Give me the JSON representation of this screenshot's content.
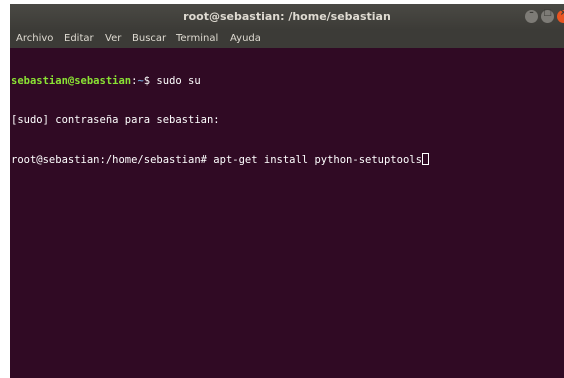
{
  "window": {
    "title": "root@sebastian: /home/sebastian"
  },
  "menu": {
    "items": [
      "Archivo",
      "Editar",
      "Ver",
      "Buscar",
      "Terminal",
      "Ayuda"
    ]
  },
  "terminal": {
    "line1": {
      "user_host": "sebastian@sebastian",
      "sep": ":",
      "path": "~",
      "prompt": "$ ",
      "command": "sudo su"
    },
    "line2": {
      "text": "[sudo] contraseña para sebastian:"
    },
    "line3": {
      "prompt": "root@sebastian:/home/sebastian# ",
      "command": "apt-get install python-setuptools"
    }
  },
  "colors": {
    "background": "#300a24",
    "prompt_user": "#8ae234",
    "prompt_path": "#729fcf",
    "titlebar": "#3c3b37",
    "close_button": "#e95420"
  }
}
